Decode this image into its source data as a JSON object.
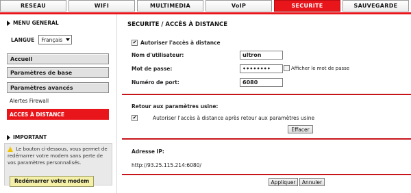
{
  "nav": {
    "tabs": [
      {
        "label": "RESEAU",
        "active": false
      },
      {
        "label": "WIFI",
        "active": false
      },
      {
        "label": "MULTIMEDIA",
        "active": false
      },
      {
        "label": "VoIP",
        "active": false
      },
      {
        "label": "SECURITE",
        "active": true
      },
      {
        "label": "SAUVEGARDE",
        "active": false
      }
    ]
  },
  "sidebar": {
    "menu_general_title": "MENU GENERAL",
    "language_label": "LANGUE",
    "language_value": "Français",
    "menu_buttons": [
      "Accueil",
      "Paramètres de base",
      "Paramètres avancés"
    ],
    "sub_items": [
      "Alertes Firewall"
    ],
    "active_item": "ACCES À DISTANCE",
    "important_title": "IMPORTANT",
    "info_text": "Le bouton ci-dessous, vous permet de redémarrer votre modem sans perte de vos paramètres personnalisés.",
    "reboot_button": "Redémarrer votre modem"
  },
  "main": {
    "title": "SECURITE / ACCÈS À DISTANCE",
    "allow_remote_label": "Autoriser l'accès à distance",
    "allow_remote_checked": true,
    "username_label": "Nom d'utilisateur:",
    "username_value": "ultron",
    "password_label": "Mot de passe:",
    "password_value": "••••••••",
    "show_password_label": "Afficher le mot de passe",
    "show_password_checked": false,
    "port_label": "Numéro de port:",
    "port_value": "6080",
    "factory_title": "Retour aux paramètres usine:",
    "factory_checkbox_label": "Autoriser l'accès à distance après retour aux paramètres usine",
    "factory_checked": true,
    "clear_button": "Effacer",
    "ip_title": "Adresse IP:",
    "ip_value": "http://93.25.115.214:6080/",
    "apply_button": "Appliquer",
    "cancel_button": "Annuler"
  },
  "colors": {
    "accent": "#e8151b",
    "menu_bg": "#e1e1e1",
    "reboot_bg": "#f4f0a7"
  },
  "icons": [
    "checkbox-checked-icon",
    "checkbox-unchecked-icon",
    "warning-icon",
    "triangle-right-icon",
    "chevron-down-icon"
  ]
}
